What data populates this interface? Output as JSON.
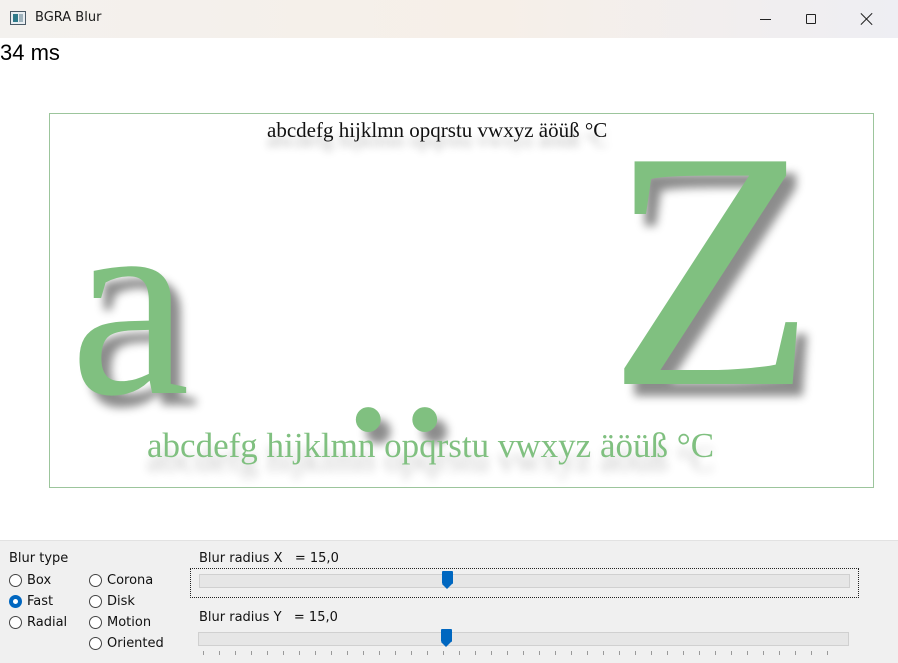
{
  "window": {
    "title": "BGRA Blur",
    "controls": [
      "minimize-icon",
      "maximize-icon",
      "close-icon"
    ]
  },
  "timing": {
    "label": "34 ms"
  },
  "canvas": {
    "small_text": "abcdefg hijklmn opqrstu vwxyz äöüß °C",
    "big_a": "a",
    "dots": "..",
    "big_z": "Z",
    "medium_text": "abcdefg hijklmn opqrstu vwxyz äöüß °C",
    "text_color": "#80c080",
    "border_color": "#9cc59c"
  },
  "controls": {
    "blur_type_label": "Blur type",
    "blur_types": [
      {
        "label": "Box",
        "checked": false
      },
      {
        "label": "Fast",
        "checked": true
      },
      {
        "label": "Radial",
        "checked": false
      },
      {
        "label": "Corona",
        "checked": false
      },
      {
        "label": "Disk",
        "checked": false
      },
      {
        "label": "Motion",
        "checked": false
      },
      {
        "label": "Oriented",
        "checked": false
      }
    ],
    "radius_x": {
      "label": "Blur radius X   = 15,0",
      "value": 15.0,
      "fraction": 0.38
    },
    "radius_y": {
      "label": "Blur radius Y   = 15,0",
      "value": 15.0,
      "fraction": 0.38
    },
    "accent_color": "#0067c0"
  }
}
